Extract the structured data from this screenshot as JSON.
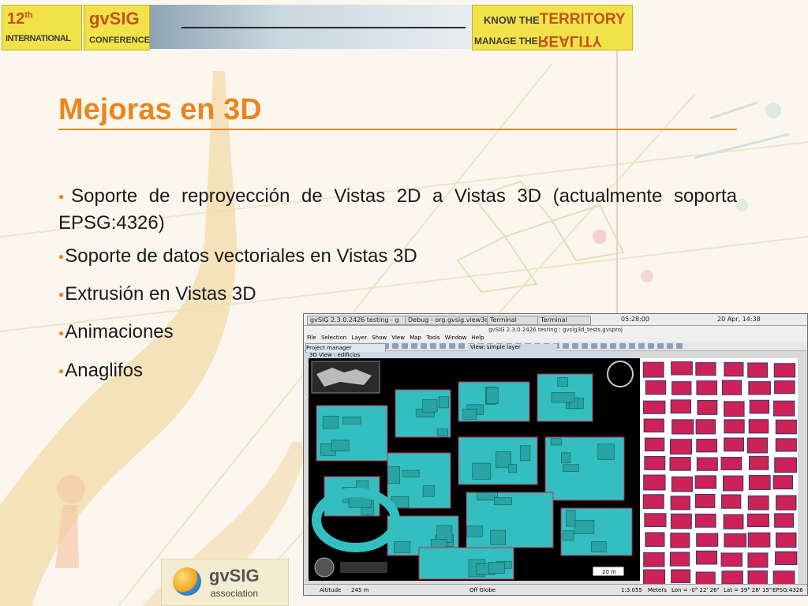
{
  "banner": {
    "edition_number": "12",
    "edition_suffix": "th",
    "edition_label": "INTERNATIONAL",
    "logo_text": "gvSIG",
    "logo_sub": "CONFERENCE",
    "motto_line1_prefix": "KNOW THE",
    "motto_line1_word": "TERRITORY",
    "motto_line2_prefix": "MANAGE THE",
    "motto_line2_word": "REALITY"
  },
  "slide": {
    "title": "Mejoras en 3D",
    "bullets": [
      "Soporte de reproyección de Vistas 2D a Vistas 3D (actualmente soporta EPSG:4326)",
      "Soporte de datos vectoriales en Vistas 3D",
      "Extrusión en Vistas 3D",
      "Animaciones",
      "Anaglifos"
    ],
    "accent_color": "#e8861e"
  },
  "screenshot": {
    "taskbar_items": [
      "gvSIG 2.3.0.2426 testing - g",
      "Debug - org.gvsig.view3d.s...",
      "Terminal",
      "Terminal"
    ],
    "clock_left": "05:28:00",
    "clock_right": "20 Apr, 14:38",
    "window_title": "gvSIG 2.3.0.2426 testing : gvsig3d_tests.gvsproj",
    "menu_items": [
      "File",
      "Selection",
      "Layer",
      "Show",
      "View",
      "Map",
      "Tools",
      "Window",
      "Help"
    ],
    "project_manager_label": "Project manager",
    "view3d_title": "3D View : edificios",
    "view2d_title": "View: simple layer",
    "status_altitude_label": "Altitude",
    "status_altitude_value": "245 m",
    "status_globe": "Off Globe",
    "status_scale": "1:3.055",
    "status_units": "Meters",
    "status_lon": "Lon = -0° 22' 26\"",
    "status_lat": "Lat = 39° 28' 15\"",
    "status_epsg": "EPSG:4326",
    "scale_bar_label": "20 m",
    "building_color": "#33bfbf",
    "outline_color": "#cc2255"
  },
  "association": {
    "name": "gvSIG",
    "subtitle": "association"
  }
}
